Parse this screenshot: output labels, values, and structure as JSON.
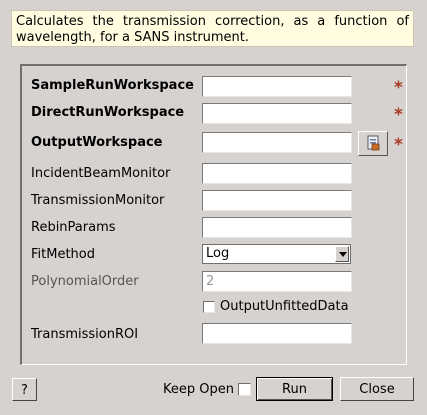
{
  "description": "Calculates the transmission correction, as a function of wavelength, for a SANS instrument.",
  "form": {
    "sample_run_label": "SampleRunWorkspace",
    "sample_run_value": "",
    "direct_run_label": "DirectRunWorkspace",
    "direct_run_value": "",
    "output_label": "OutputWorkspace",
    "output_value": "",
    "incident_monitor_label": "IncidentBeamMonitor",
    "incident_monitor_value": "",
    "transmission_monitor_label": "TransmissionMonitor",
    "transmission_monitor_value": "",
    "rebin_label": "RebinParams",
    "rebin_value": "",
    "fit_method_label": "FitMethod",
    "fit_method_value": "Log",
    "poly_order_label": "PolynomialOrder",
    "poly_order_value": "2",
    "unfitted_label": "OutputUnfittedData",
    "unfitted_checked": false,
    "roi_label": "TransmissionROI",
    "roi_value": "",
    "required_marker": "*",
    "required_color": "#a83a22",
    "file_button_icon": "workspace-file-icon"
  },
  "footer": {
    "help_label": "?",
    "keep_open_label": "Keep Open",
    "keep_open_checked": false,
    "run_label": "Run",
    "close_label": "Close"
  }
}
